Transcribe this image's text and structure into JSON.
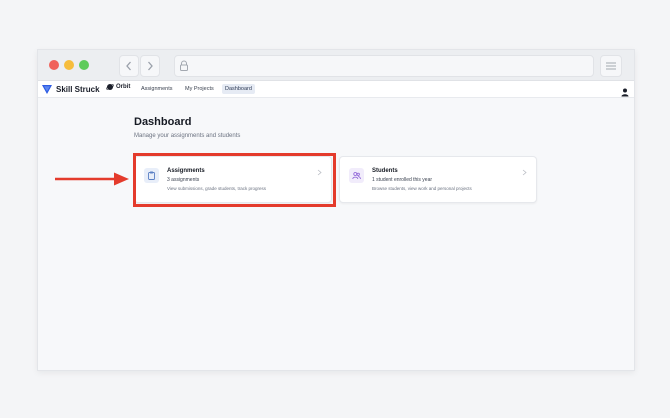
{
  "app": {
    "brand_name": "Skill Struck",
    "product_name": "Orbit",
    "nav": {
      "assignments": "Assignments",
      "my_projects": "My Projects",
      "dashboard": "Dashboard"
    }
  },
  "page": {
    "title": "Dashboard",
    "subtitle": "Manage your assignments and students"
  },
  "cards": {
    "assignments": {
      "title": "Assignments",
      "line1": "3 assignments",
      "line2": "View submissions, grade students, track progress",
      "icon": "clipboard-icon"
    },
    "students": {
      "title": "Students",
      "line1": "1 student enrolled this year",
      "line2": "Browse students, view work and personal projects",
      "icon": "users-icon"
    }
  },
  "colors": {
    "brand_blue": "#2d5be3",
    "highlight_red": "#e43b2c",
    "assignments_icon_bg": "#e8eef9",
    "assignments_icon": "#5a7fc4",
    "students_icon_bg": "#f1ecfb",
    "students_icon": "#8a5cd6"
  }
}
